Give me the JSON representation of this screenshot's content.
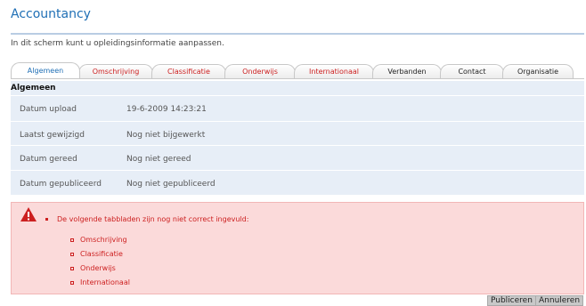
{
  "page": {
    "title": "Accountancy",
    "intro": "In dit scherm kunt u opleidingsinformatie aanpassen."
  },
  "tabs": [
    {
      "label": "Algemeen",
      "state": "active"
    },
    {
      "label": "Omschrijving",
      "state": "error"
    },
    {
      "label": "Classificatie",
      "state": "error"
    },
    {
      "label": "Onderwijs",
      "state": "error"
    },
    {
      "label": "Internationaal",
      "state": "error"
    },
    {
      "label": "Verbanden",
      "state": "normal"
    },
    {
      "label": "Contact",
      "state": "normal"
    },
    {
      "label": "Organisatie",
      "state": "normal"
    }
  ],
  "section": {
    "heading": "Algemeen",
    "rows": [
      {
        "label": "Datum upload",
        "value": "19-6-2009 14:23:21"
      },
      {
        "label": "Laatst gewijzigd",
        "value": "Nog niet bijgewerkt"
      },
      {
        "label": "Datum gereed",
        "value": "Nog niet gereed"
      },
      {
        "label": "Datum gepubliceerd",
        "value": "Nog niet gepubliceerd"
      }
    ]
  },
  "alert": {
    "icon": "warning-triangle-icon",
    "message": "De volgende tabbladen zijn nog niet correct ingevuld:",
    "items": [
      "Omschrijving",
      "Classificatie",
      "Onderwijs",
      "Internationaal"
    ]
  },
  "actions": {
    "publish_label": "Publiceren",
    "cancel_label": "Annuleren"
  },
  "colors": {
    "title": "#1f6fb5",
    "error": "#cc1f1f",
    "alert_bg": "#fbdada",
    "section_bg": "#e7eef7"
  }
}
